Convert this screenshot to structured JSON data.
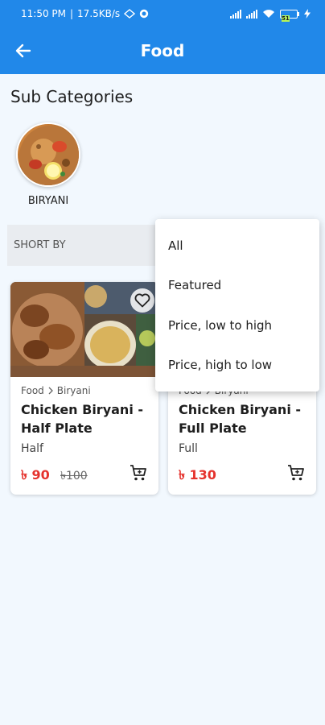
{
  "status_bar": {
    "time": "11:50 PM",
    "net_speed": "17.5KB/s",
    "battery": "51"
  },
  "app_bar": {
    "title": "Food",
    "back_icon": "arrow-left-icon"
  },
  "subcategories": {
    "title": "Sub Categories",
    "items": [
      {
        "label": "BIRYANI",
        "image": "biryani-photo"
      }
    ]
  },
  "sort": {
    "label": "SHORT BY",
    "options": [
      "All",
      "Featured",
      "Price, low to high",
      "Price, high to low"
    ]
  },
  "products": [
    {
      "breadcrumb": [
        "Food",
        "Biryani"
      ],
      "name": "Chicken Biryani - Half Plate",
      "variant": "Half",
      "price": "৳ 90",
      "old_price": "৳100",
      "fav_icon": "heart-outline-icon",
      "cart_icon": "cart-icon"
    },
    {
      "breadcrumb": [
        "Food",
        "Biryani"
      ],
      "name": "Chicken Biryani - Full Plate",
      "variant": "Full",
      "price": "৳ 130",
      "cart_icon": "cart-icon"
    }
  ],
  "colors": {
    "primary": "#2188e9",
    "price": "#e5322d",
    "background": "#f2f8fe"
  }
}
